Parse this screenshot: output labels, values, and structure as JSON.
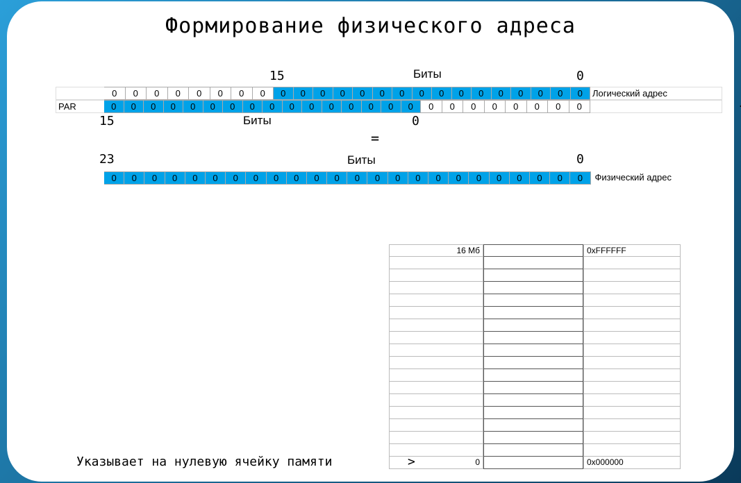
{
  "title": "Формирование физического адреса",
  "logical": {
    "label": "Логический адрес",
    "hi_bit": "15",
    "bits_word": "Биты",
    "lo_bit": "0",
    "upper_bits": [
      "0",
      "0",
      "0",
      "0",
      "0",
      "0",
      "0",
      "0"
    ],
    "lower_bits": [
      "0",
      "0",
      "0",
      "0",
      "0",
      "0",
      "0",
      "0",
      "0",
      "0",
      "0",
      "0",
      "0",
      "0",
      "0",
      "0"
    ]
  },
  "par": {
    "label": "PAR",
    "hi_bit": "15",
    "bits_word": "Биты",
    "lo_bit": "0",
    "upper_bits": [
      "0",
      "0",
      "0",
      "0",
      "0",
      "0",
      "0",
      "0",
      "0",
      "0",
      "0",
      "0",
      "0",
      "0",
      "0",
      "0"
    ],
    "lower_bits": [
      "0",
      "0",
      "0",
      "0",
      "0",
      "0",
      "0",
      "0"
    ]
  },
  "operators": {
    "plus": "+",
    "equals": "="
  },
  "physical": {
    "label": "Физический адрес",
    "hi_bit": "23",
    "bits_word": "Биты",
    "lo_bit": "0",
    "bits": [
      "0",
      "0",
      "0",
      "0",
      "0",
      "0",
      "0",
      "0",
      "0",
      "0",
      "0",
      "0",
      "0",
      "0",
      "0",
      "0",
      "0",
      "0",
      "0",
      "0",
      "0",
      "0",
      "0",
      "0"
    ]
  },
  "memmap": {
    "top_size": "16 Мб",
    "top_addr": "0xFFFFFF",
    "bottom_size": "0",
    "bottom_addr": "0x000000",
    "rows": 18
  },
  "caption": "Указывает на нулевую ячейку памяти",
  "arrow": ">"
}
